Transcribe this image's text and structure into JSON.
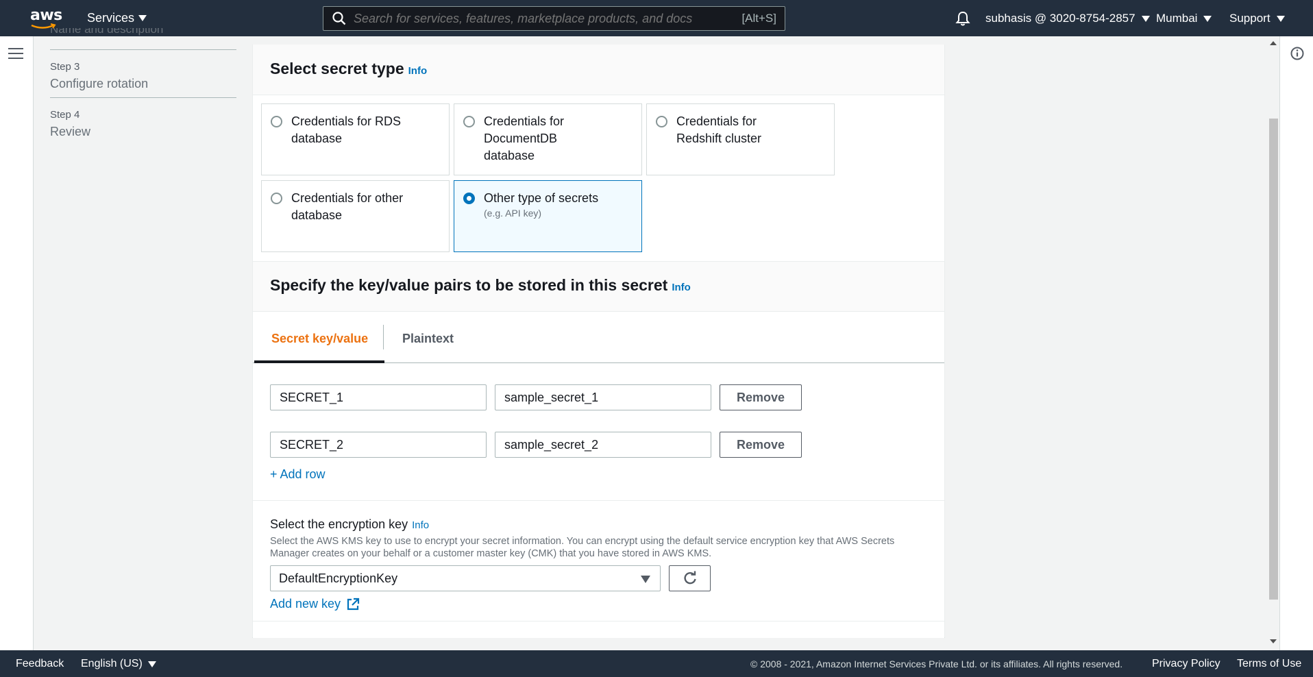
{
  "topnav": {
    "logo_text": "aws",
    "services_label": "Services",
    "search_placeholder": "Search for services, features, marketplace products, and docs",
    "search_shortcut": "[Alt+S]",
    "account_label": "subhasis @ 3020-8754-2857",
    "region_label": "Mumbai",
    "support_label": "Support"
  },
  "steps": {
    "cut_title": "Name and description",
    "items": [
      {
        "label": "Step 3",
        "title": "Configure rotation"
      },
      {
        "label": "Step 4",
        "title": "Review"
      }
    ]
  },
  "secret_type": {
    "heading": "Select secret type",
    "info": "Info",
    "options": [
      {
        "line1": "Credentials for RDS",
        "line2": "database",
        "line3": "",
        "selected": false
      },
      {
        "line1": "Credentials for",
        "line2": "DocumentDB",
        "line3": "database",
        "selected": false
      },
      {
        "line1": "Credentials for",
        "line2": "Redshift cluster",
        "line3": "",
        "selected": false
      },
      {
        "line1": "Credentials for other",
        "line2": "database",
        "line3": "",
        "selected": false
      },
      {
        "line1": "Other type of secrets",
        "line2": "(e.g. API key)",
        "line3": "",
        "selected": true
      }
    ]
  },
  "kv": {
    "heading": "Specify the key/value pairs to be stored in this secret",
    "info": "Info",
    "tabs": [
      {
        "label": "Secret key/value",
        "active": true
      },
      {
        "label": "Plaintext",
        "active": false
      }
    ],
    "rows": [
      {
        "key": "SECRET_1",
        "value": "sample_secret_1",
        "remove_label": "Remove"
      },
      {
        "key": "SECRET_2",
        "value": "sample_secret_2",
        "remove_label": "Remove"
      }
    ],
    "add_row_label": "+ Add row"
  },
  "encryption": {
    "label": "Select the encryption key",
    "info": "Info",
    "description": "Select the AWS KMS key to use to encrypt your secret information. You can encrypt using the default service encryption key that AWS Secrets Manager creates on your behalf or a customer master key (CMK) that you have stored in AWS KMS.",
    "selected_key": "DefaultEncryptionKey",
    "add_key_label": "Add new key"
  },
  "footer": {
    "feedback": "Feedback",
    "language": "English (US)",
    "copyright": "© 2008 - 2021, Amazon Internet Services Private Ltd. or its affiliates. All rights reserved.",
    "privacy": "Privacy Policy",
    "terms": "Terms of Use"
  },
  "colors": {
    "nav_bg": "#232f3e",
    "link": "#0073bb",
    "active_tab": "#ec7211",
    "selected_card_bg": "#f1faff"
  }
}
